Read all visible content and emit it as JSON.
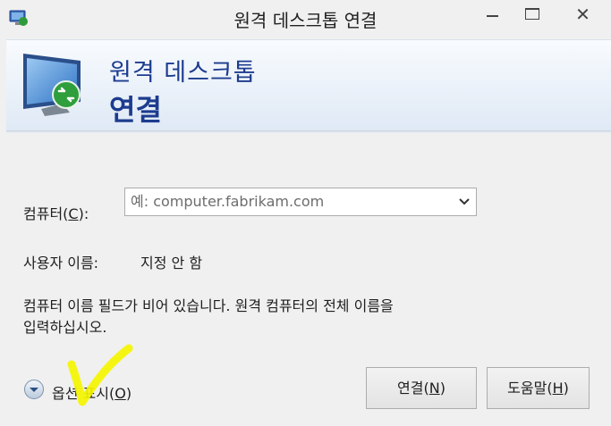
{
  "window": {
    "title": "원격 데스크톱 연결",
    "close_glyph": "✕"
  },
  "banner": {
    "line1": "원격 데스크톱",
    "line2": "연결"
  },
  "computer": {
    "label_text": "컴퓨터(",
    "label_key": "C",
    "label_tail": "):",
    "placeholder": "예: computer.fabrikam.com"
  },
  "user": {
    "label": "사용자 이름:",
    "value": "지정 안 함"
  },
  "message": {
    "line1": "컴퓨터 이름 필드가 비어 있습니다. 원격 컴퓨터의 전체 이름을",
    "line2": "입력하십시오."
  },
  "options": {
    "label_text": "옵션 표시(",
    "label_key": "O",
    "label_tail": ")"
  },
  "buttons": {
    "connect_text": "연결(",
    "connect_key": "N",
    "connect_tail": ")",
    "help_text": "도움말(",
    "help_key": "H",
    "help_tail": ")"
  },
  "colors": {
    "banner_text": "#1d3c8f",
    "annotation": "#f5f500"
  }
}
